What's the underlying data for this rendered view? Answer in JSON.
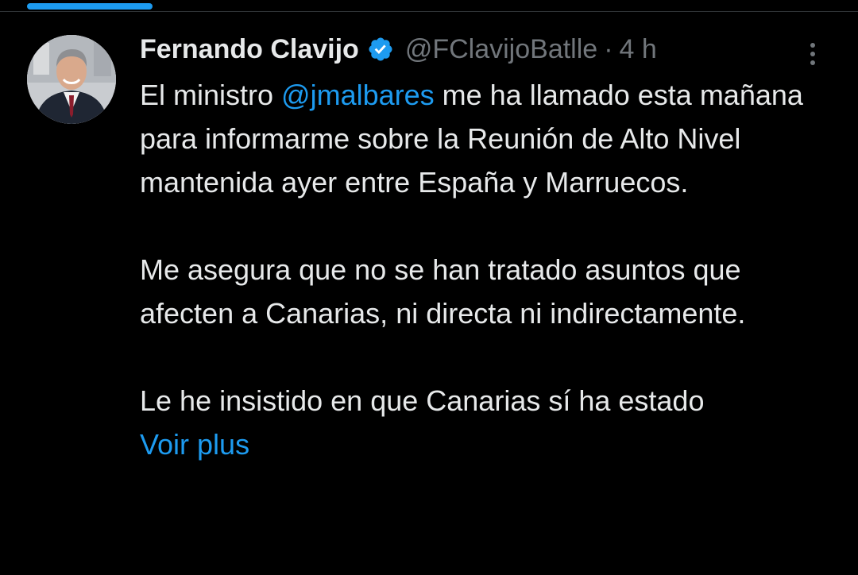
{
  "tweet": {
    "author_name": "Fernando Clavijo",
    "verified_icon": "verified-badge-icon",
    "handle": "@FClavijoBatlle",
    "separator": "·",
    "time": "4 h",
    "more_icon": "more-options-icon",
    "paragraph1": {
      "before_mention": "El ministro ",
      "mention": "@jmalbares",
      "after_mention": " me ha llamado esta mañana para informarme sobre la Reunión de Alto Nivel mantenida ayer entre España y Marruecos."
    },
    "paragraph2": "Me asegura que no se han tratado asuntos que afecten a Canarias, ni directa ni indirectamente.",
    "paragraph3": "Le he insistido en que Canarias sí ha estado",
    "voir_plus": "Voir plus"
  },
  "colors": {
    "background": "#000000",
    "text": "#e7e9ea",
    "secondary": "#71767b",
    "accent": "#1d9bf0"
  }
}
